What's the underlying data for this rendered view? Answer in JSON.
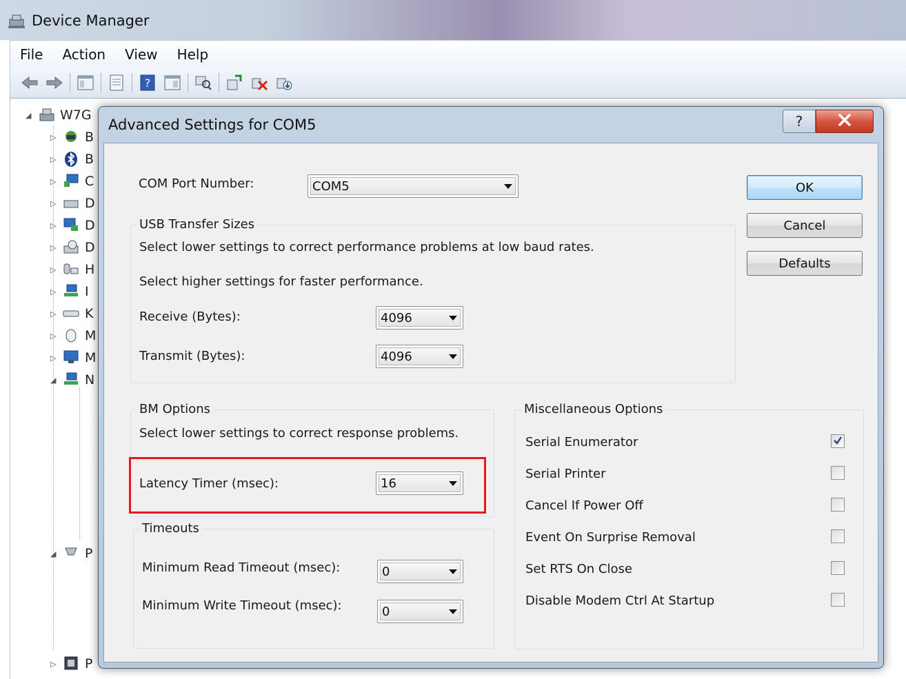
{
  "window": {
    "title": "Device Manager"
  },
  "menu": {
    "items": [
      "File",
      "Action",
      "View",
      "Help"
    ]
  },
  "tree": {
    "root_label": "W7G",
    "node_letters": [
      "B",
      "B",
      "C",
      "D",
      "D",
      "D",
      "H",
      "I",
      "K",
      "M",
      "M",
      "N",
      "P",
      "P"
    ]
  },
  "dialog": {
    "title": "Advanced Settings for COM5",
    "help_symbol": "?",
    "com_port_label": "COM Port Number:",
    "com_port_value": "COM5",
    "buttons": {
      "ok": "OK",
      "cancel": "Cancel",
      "defaults": "Defaults"
    },
    "usb": {
      "group_label": "USB Transfer Sizes",
      "desc1": "Select lower settings to correct performance problems at low baud rates.",
      "desc2": "Select higher settings for faster performance.",
      "receive_label": "Receive (Bytes):",
      "receive_value": "4096",
      "transmit_label": "Transmit (Bytes):",
      "transmit_value": "4096"
    },
    "bm": {
      "group_label": "BM Options",
      "desc": "Select lower settings to correct response problems.",
      "latency_label": "Latency Timer (msec):",
      "latency_value": "16"
    },
    "timeouts": {
      "group_label": "Timeouts",
      "min_read_label": "Minimum Read Timeout (msec):",
      "min_read_value": "0",
      "min_write_label": "Minimum Write Timeout (msec):",
      "min_write_value": "0"
    },
    "misc": {
      "group_label": "Miscellaneous Options",
      "options": [
        {
          "label": "Serial Enumerator",
          "checked": true
        },
        {
          "label": "Serial Printer",
          "checked": false
        },
        {
          "label": "Cancel If Power Off",
          "checked": false
        },
        {
          "label": "Event On Surprise Removal",
          "checked": false
        },
        {
          "label": "Set RTS On Close",
          "checked": false
        },
        {
          "label": "Disable Modem Ctrl At Startup",
          "checked": false
        }
      ]
    }
  },
  "colors": {
    "highlight": "#e8141c",
    "ok_border": "#3c7fb1",
    "close_red": "#c23a22"
  }
}
